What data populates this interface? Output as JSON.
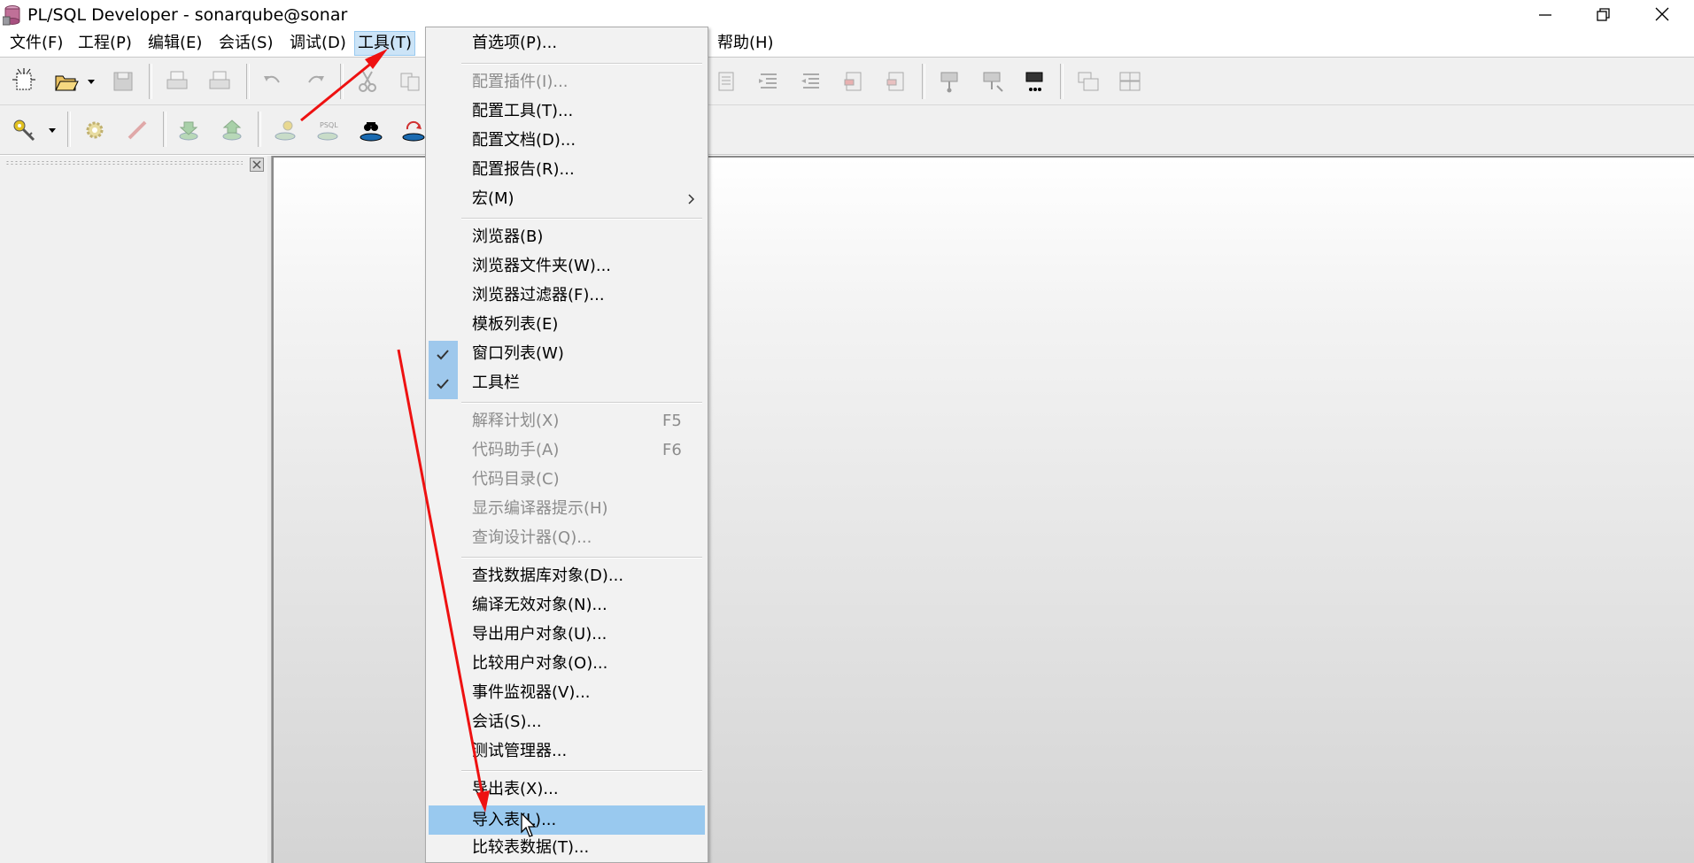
{
  "window": {
    "title": "PL/SQL Developer - sonarqube@sonar"
  },
  "menubar": [
    "文件(F)",
    "工程(P)",
    "编辑(E)",
    "会话(S)",
    "调试(D)",
    "工具(T)",
    "帮助(H)"
  ],
  "active_menu": "工具(T)",
  "tools_menu": {
    "items": [
      {
        "label": "首选项(P)...",
        "enabled": true
      },
      {
        "label": "配置插件(I)...",
        "enabled": false
      },
      {
        "label": "配置工具(T)...",
        "enabled": true
      },
      {
        "label": "配置文档(D)...",
        "enabled": true
      },
      {
        "label": "配置报告(R)...",
        "enabled": true
      },
      {
        "label": "宏(M)",
        "enabled": true,
        "submenu": true
      },
      {
        "label": "浏览器(B)",
        "enabled": true
      },
      {
        "label": "浏览器文件夹(W)...",
        "enabled": true
      },
      {
        "label": "浏览器过滤器(F)...",
        "enabled": true
      },
      {
        "label": "模板列表(E)",
        "enabled": true
      },
      {
        "label": "窗口列表(W)",
        "enabled": true,
        "checked": true
      },
      {
        "label": "工具栏",
        "enabled": true,
        "checked": true
      },
      {
        "label": "解释计划(X)",
        "enabled": false,
        "shortcut": "F5"
      },
      {
        "label": "代码助手(A)",
        "enabled": false,
        "shortcut": "F6"
      },
      {
        "label": "代码目录(C)",
        "enabled": false
      },
      {
        "label": "显示编译器提示(H)",
        "enabled": false
      },
      {
        "label": "查询设计器(Q)...",
        "enabled": false
      },
      {
        "label": "查找数据库对象(D)...",
        "enabled": true
      },
      {
        "label": "编译无效对象(N)...",
        "enabled": true
      },
      {
        "label": "导出用户对象(U)...",
        "enabled": true
      },
      {
        "label": "比较用户对象(O)...",
        "enabled": true
      },
      {
        "label": "事件监视器(V)...",
        "enabled": true
      },
      {
        "label": "会话(S)...",
        "enabled": true
      },
      {
        "label": "测试管理器...",
        "enabled": true
      },
      {
        "label": "导出表(X)...",
        "enabled": true
      },
      {
        "label": "导入表(L)...",
        "enabled": true,
        "highlighted": true
      },
      {
        "label": "比较表数据(T)...",
        "enabled": true
      }
    ]
  },
  "colors": {
    "menu_highlight": "#99c9ef",
    "check_bg": "#9ec8ec",
    "annotation_arrow": "#ee1111",
    "disabled_text": "#8c8c8c"
  },
  "icons": {
    "toolbar1": [
      "new-icon",
      "open-folder-icon",
      "dropdown-arrow-icon",
      "save-icon",
      "print-icon",
      "print-preview-icon",
      "undo-icon",
      "redo-icon",
      "cut-icon",
      "copy-icon",
      "indent-icon",
      "unindent-icon",
      "align-icon",
      "comment-icon",
      "uncomment-icon",
      "debug-icon",
      "step-icon",
      "run-icon",
      "cascade-windows-icon",
      "tile-windows-icon"
    ],
    "toolbar2": [
      "logon-key-icon",
      "dropdown-arrow-icon",
      "execute-gear-icon",
      "break-icon",
      "commit-icon",
      "rollback-icon",
      "sql-connect-icon",
      "psql-icon",
      "find-db-objects-icon",
      "recompile-icon"
    ]
  }
}
